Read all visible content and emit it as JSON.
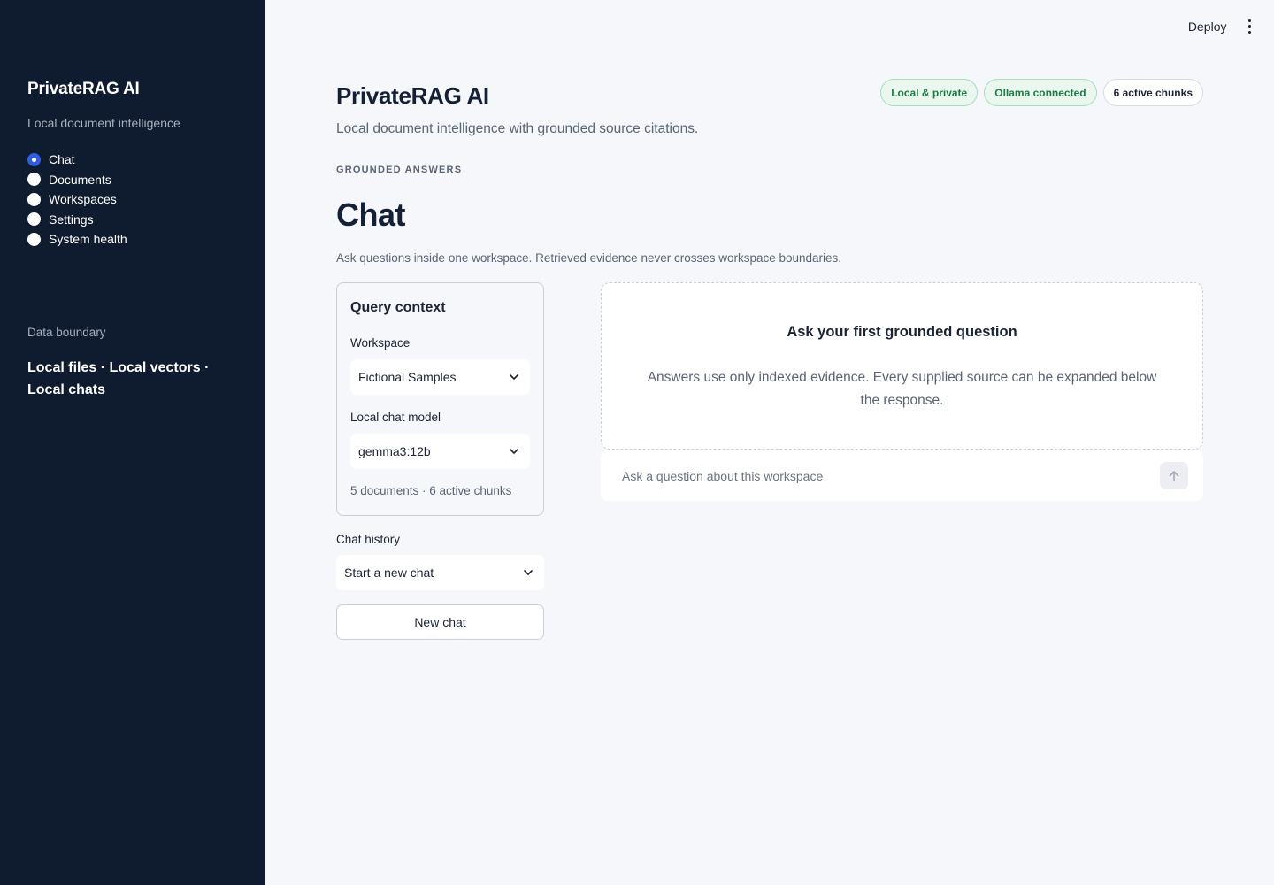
{
  "sidebar": {
    "title": "PrivateRAG AI",
    "subtitle": "Local document intelligence",
    "nav": [
      {
        "label": "Chat",
        "selected": true
      },
      {
        "label": "Documents",
        "selected": false
      },
      {
        "label": "Workspaces",
        "selected": false
      },
      {
        "label": "Settings",
        "selected": false
      },
      {
        "label": "System health",
        "selected": false
      }
    ],
    "boundary_label": "Data boundary",
    "boundary_text": "Local files · Local vectors · Local chats"
  },
  "topbar": {
    "deploy_label": "Deploy",
    "menu_icon": "kebab-menu-icon"
  },
  "header": {
    "title": "PrivateRAG AI",
    "subtitle": "Local document intelligence with grounded source citations.",
    "badges": [
      {
        "label": "Local & private",
        "color": "#1e7a45"
      },
      {
        "label": "Ollama connected",
        "color": "#1e7a45"
      },
      {
        "label": "6 active chunks",
        "color": "#1b2333"
      }
    ]
  },
  "page": {
    "eyebrow": "GROUNDED ANSWERS",
    "title": "Chat",
    "description": "Ask questions inside one workspace. Retrieved evidence never crosses workspace boundaries."
  },
  "query_context": {
    "title": "Query context",
    "workspace_label": "Workspace",
    "workspace_value": "Fictional Samples",
    "model_label": "Local chat model",
    "model_value": "gemma3:12b",
    "meta": "5 documents · 6 active chunks"
  },
  "chat_history": {
    "label": "Chat history",
    "value": "Start a new chat",
    "new_chat_label": "New chat"
  },
  "empty_state": {
    "title": "Ask your first grounded question",
    "text": "Answers use only indexed evidence. Every supplied source can be expanded below the response."
  },
  "chat_input": {
    "placeholder": "Ask a question about this workspace",
    "send_icon": "arrow-up-icon"
  },
  "colors": {
    "sidebar_bg": "#0f1b2e",
    "accent": "#2f5fe0",
    "success": "#1e7a45"
  }
}
